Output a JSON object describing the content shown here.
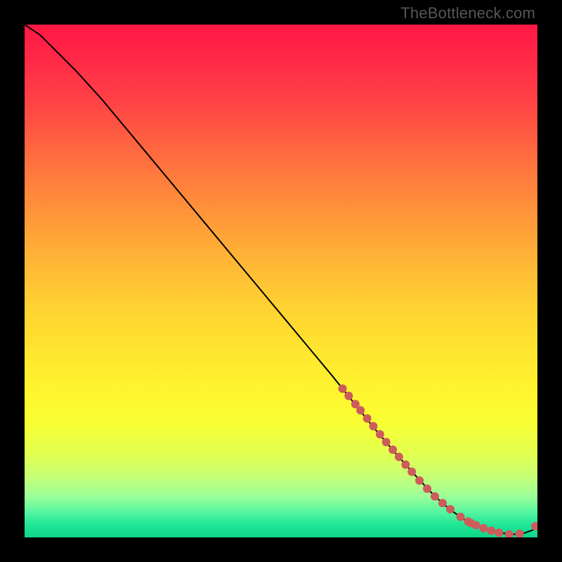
{
  "watermark": "TheBottleneck.com",
  "chart_data": {
    "type": "line",
    "title": "",
    "xlabel": "",
    "ylabel": "",
    "xlim": [
      0,
      100
    ],
    "ylim": [
      0,
      100
    ],
    "grid": false,
    "legend": false,
    "gradient_stops": [
      {
        "pos": 0.0,
        "color": "#ff1744"
      },
      {
        "pos": 0.07,
        "color": "#ff2a47"
      },
      {
        "pos": 0.15,
        "color": "#ff4245"
      },
      {
        "pos": 0.25,
        "color": "#ff6a3f"
      },
      {
        "pos": 0.35,
        "color": "#ff8e3a"
      },
      {
        "pos": 0.45,
        "color": "#ffb236"
      },
      {
        "pos": 0.55,
        "color": "#ffd232"
      },
      {
        "pos": 0.65,
        "color": "#ffe82f"
      },
      {
        "pos": 0.72,
        "color": "#fff62f"
      },
      {
        "pos": 0.78,
        "color": "#f8ff34"
      },
      {
        "pos": 0.84,
        "color": "#e0ff52"
      },
      {
        "pos": 0.88,
        "color": "#c8ff75"
      },
      {
        "pos": 0.92,
        "color": "#9cff99"
      },
      {
        "pos": 0.95,
        "color": "#58f5a0"
      },
      {
        "pos": 0.975,
        "color": "#20e696"
      },
      {
        "pos": 1.0,
        "color": "#10d688"
      }
    ],
    "series": [
      {
        "name": "curve",
        "type": "line",
        "color": "#000000",
        "width": 2,
        "x": [
          0,
          3,
          6,
          10,
          15,
          20,
          25,
          30,
          35,
          40,
          45,
          50,
          55,
          60,
          64,
          68,
          72,
          76,
          80,
          83,
          86,
          89,
          92,
          95,
          97,
          99,
          100
        ],
        "y": [
          100,
          98,
          95,
          91,
          85.5,
          79.5,
          73.5,
          67.5,
          61.5,
          55.5,
          49.5,
          43.5,
          37.5,
          31.5,
          26.5,
          21.5,
          16.8,
          12.3,
          8.0,
          5.4,
          3.3,
          1.9,
          1.0,
          0.6,
          0.7,
          1.4,
          2.2
        ]
      },
      {
        "name": "markers",
        "type": "scatter",
        "color": "#cd5c5c",
        "size": 6,
        "x": [
          62,
          63.2,
          64.5,
          65.5,
          66.8,
          68,
          69.3,
          70.5,
          71.8,
          73,
          74.3,
          75.5,
          77,
          78.5,
          80,
          81.5,
          83,
          85,
          86.5,
          87,
          88,
          89.5,
          91,
          92.5,
          94.5,
          96.5,
          99.6
        ],
        "y": [
          29,
          27.6,
          26,
          24.8,
          23.2,
          21.7,
          20.1,
          18.6,
          17.1,
          15.7,
          14.2,
          12.8,
          11.1,
          9.5,
          8.0,
          6.7,
          5.5,
          4.0,
          3.1,
          2.8,
          2.4,
          1.8,
          1.3,
          0.9,
          0.6,
          0.7,
          2.2
        ]
      }
    ]
  }
}
